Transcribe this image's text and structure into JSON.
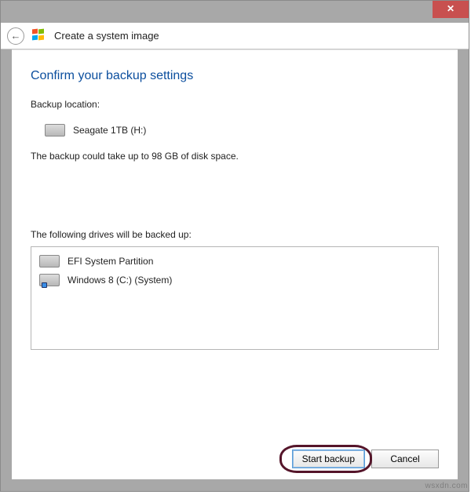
{
  "window": {
    "title": "Create a system image"
  },
  "page": {
    "heading": "Confirm your backup settings",
    "location_label": "Backup location:",
    "location_value": "Seagate 1TB (H:)",
    "space_note": "The backup could take up to 98 GB of disk space.",
    "drives_label": "The following drives will be backed up:",
    "drives": [
      {
        "name": "EFI System Partition"
      },
      {
        "name": "Windows 8 (C:) (System)"
      }
    ]
  },
  "buttons": {
    "start": "Start backup",
    "cancel": "Cancel"
  },
  "watermark": "wsxdn.com"
}
